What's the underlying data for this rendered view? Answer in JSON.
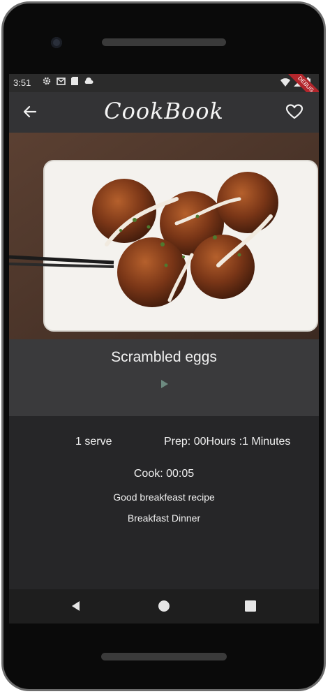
{
  "status_bar": {
    "time": "3:51",
    "debug_label": "DEBUG"
  },
  "app_bar": {
    "title": "CookBook"
  },
  "recipe": {
    "name": "Scrambled eggs",
    "serves": "1 serve",
    "prep": "Prep: 00Hours :1 Minutes",
    "cook": "Cook: 00:05",
    "description": "Good breakfeast recipe",
    "tags": "Breakfast Dinner"
  },
  "colors": {
    "screen_bg": "#262628",
    "app_bar": "#333335",
    "header_panel": "#3a3a3c",
    "debug_banner": "#b3262c"
  }
}
